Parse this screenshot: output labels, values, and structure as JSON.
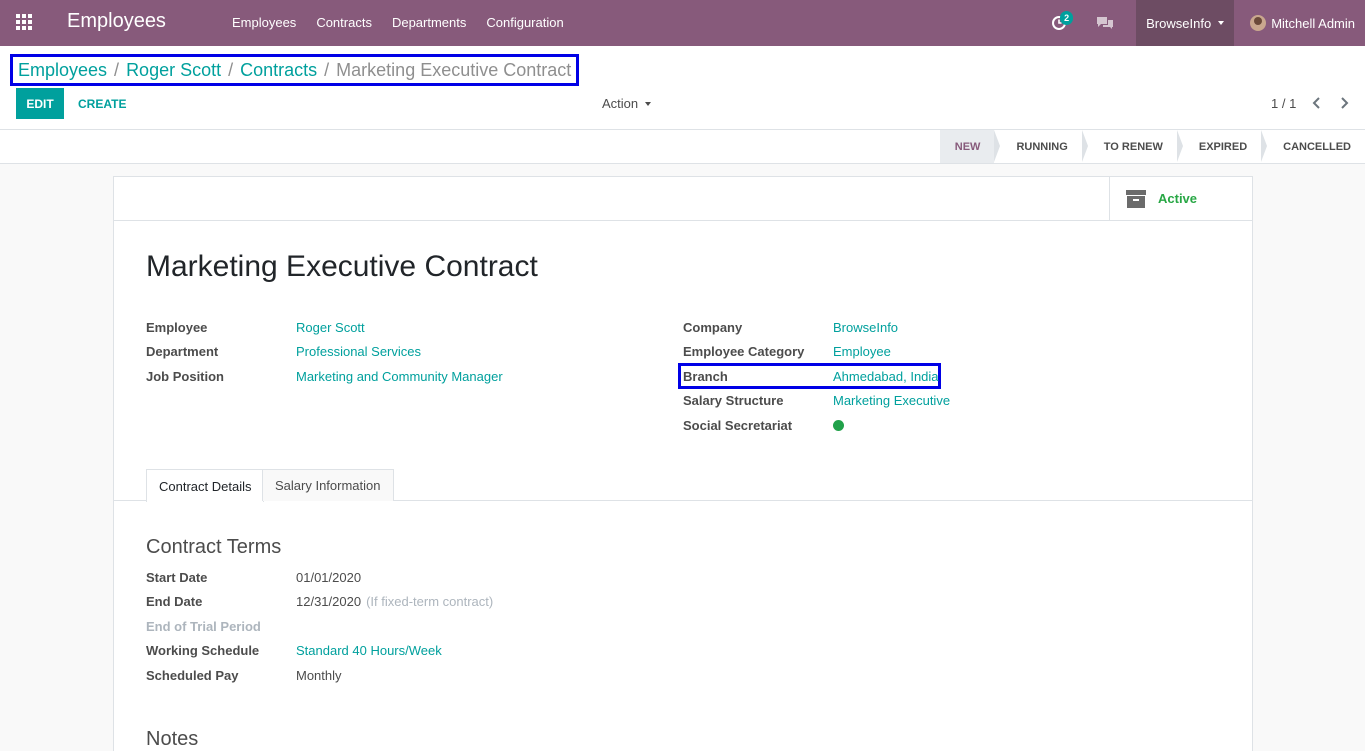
{
  "navbar": {
    "app_title": "Employees",
    "menu": [
      "Employees",
      "Contracts",
      "Departments",
      "Configuration"
    ],
    "activity_count": "2",
    "company": "BrowseInfo",
    "user": "Mitchell Admin"
  },
  "breadcrumb": {
    "items": [
      "Employees",
      "Roger Scott",
      "Contracts"
    ],
    "separator": "/",
    "current": "Marketing Executive Contract"
  },
  "toolbar": {
    "edit": "EDIT",
    "create": "CREATE",
    "action": "Action",
    "pager": "1 / 1"
  },
  "statusbar": [
    "NEW",
    "RUNNING",
    "TO RENEW",
    "EXPIRED",
    "CANCELLED"
  ],
  "statusbar_active": "NEW",
  "active_button": "Active",
  "record": {
    "title": "Marketing Executive Contract",
    "left": [
      {
        "label": "Employee",
        "value": "Roger Scott"
      },
      {
        "label": "Department",
        "value": "Professional Services"
      },
      {
        "label": "Job Position",
        "value": "Marketing and Community Manager"
      }
    ],
    "right": [
      {
        "label": "Company",
        "value": "BrowseInfo"
      },
      {
        "label": "Employee Category",
        "value": "Employee"
      },
      {
        "label": "Branch",
        "value": "Ahmedabad, India"
      },
      {
        "label": "Salary Structure",
        "value": "Marketing Executive"
      },
      {
        "label": "Social Secretariat",
        "value": ""
      }
    ]
  },
  "tabs": [
    "Contract Details",
    "Salary Information"
  ],
  "contract_terms": {
    "heading": "Contract Terms",
    "start_date_label": "Start Date",
    "start_date": "01/01/2020",
    "end_date_label": "End Date",
    "end_date": "12/31/2020",
    "end_date_hint": "(If fixed-term contract)",
    "trial_label": "End of Trial Period",
    "schedule_label": "Working Schedule",
    "schedule": "Standard 40 Hours/Week",
    "pay_label": "Scheduled Pay",
    "pay": "Monthly"
  },
  "notes_heading": "Notes",
  "colors": {
    "navbar": "#875a7b",
    "accent": "#00a09d",
    "highlight_box": "#0000e6",
    "active_green": "#28a745"
  }
}
